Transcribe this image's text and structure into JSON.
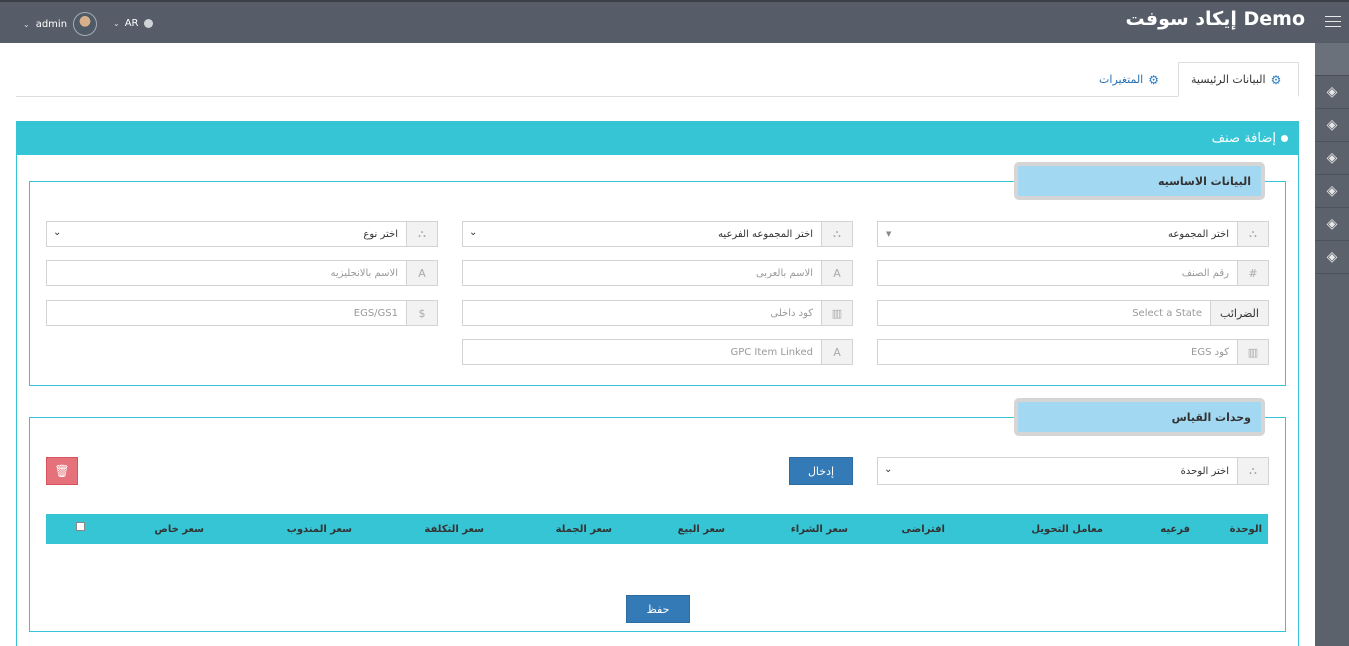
{
  "header": {
    "brand": "إيكاد سوفت Demo",
    "user": "admin",
    "language": "AR",
    "icons": [
      "hamburger-icon",
      "globe-icon",
      "chevron-down-icon"
    ]
  },
  "sidebar": {
    "items": [
      "layers-icon",
      "layers-icon",
      "layers-icon",
      "layers-icon",
      "layers-icon",
      "layers-icon"
    ]
  },
  "tabs": {
    "main": "البيانات الرئيسية",
    "variables": "المتغيرات"
  },
  "portlet": {
    "title": "إضافة صنف"
  },
  "basic": {
    "legend": "البيانات الاساسيه",
    "group": "اختر المجموعه",
    "subgroup": "اختر المجموعه الفرعيه",
    "type": "اختر نوع",
    "item_no_placeholder": "رقم الصنف",
    "name_ar_placeholder": "الاسم بالعربى",
    "name_en_placeholder": "الاسم بالانجليزيه",
    "tax_label": "الضرائب",
    "tax_placeholder": "Select a State",
    "internal_code_placeholder": "كود داخلى",
    "egs_gs1_placeholder": "EGS/GS1",
    "egs_code_placeholder": "EGS كود",
    "gpc_placeholder": "GPC Item Linked"
  },
  "units": {
    "legend": "وحدات القياس",
    "unit_select": "اختر الوحدة",
    "insert_button": "إدخال",
    "delete_icon": "trash-icon",
    "columns": [
      "الوحدة",
      "فرعيه",
      "معامل التحويل",
      "افتراضى",
      "سعر الشراء",
      "سعر البيع",
      "سعر الجملة",
      "سعر التكلفة",
      "سعر المندوب",
      "سعر خاص"
    ],
    "save_button": "حفظ"
  },
  "colors": {
    "accent": "#36c5d5",
    "topbar": "#565d68",
    "legend_bg": "#a3d8f2",
    "primary": "#337ab7",
    "danger": "#e5717a"
  }
}
